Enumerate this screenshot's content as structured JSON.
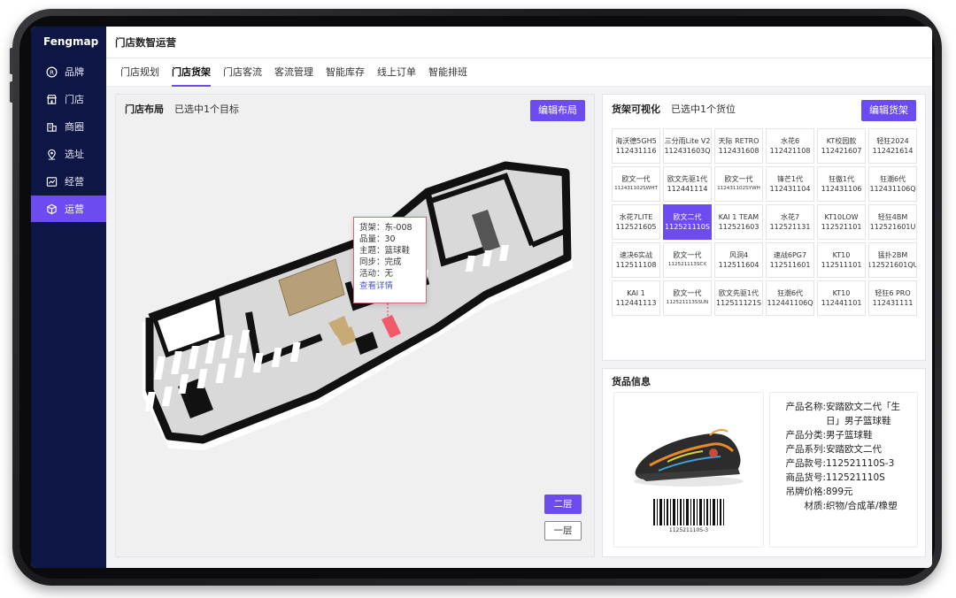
{
  "app": {
    "brand": "Fengmap",
    "title": "门店数智运营"
  },
  "sidebar": {
    "items": [
      {
        "label": "品牌",
        "icon": "registered-icon",
        "active": false
      },
      {
        "label": "门店",
        "icon": "store-icon",
        "active": false
      },
      {
        "label": "商圈",
        "icon": "building-icon",
        "active": false
      },
      {
        "label": "选址",
        "icon": "location-pin-icon",
        "active": false
      },
      {
        "label": "经营",
        "icon": "chart-line-icon",
        "active": false
      },
      {
        "label": "运营",
        "icon": "cube-icon",
        "active": true
      }
    ]
  },
  "tabs": [
    {
      "label": "门店规划",
      "active": false
    },
    {
      "label": "门店货架",
      "active": true
    },
    {
      "label": "门店客流",
      "active": false
    },
    {
      "label": "客流管理",
      "active": false
    },
    {
      "label": "智能库存",
      "active": false
    },
    {
      "label": "线上订单",
      "active": false
    },
    {
      "label": "智能排班",
      "active": false
    }
  ],
  "layout_panel": {
    "title": "门店布局",
    "status": "已选中1个目标",
    "edit_button": "编辑布局",
    "tooltip": {
      "lines": [
        "货架：东-008",
        "品量：30",
        "主题：篮球鞋",
        "同步：完成",
        "活动：无"
      ],
      "link": "查看详情"
    },
    "floors": [
      "二层",
      "一层"
    ]
  },
  "shelf_panel": {
    "title": "货架可视化",
    "status": "已选中1个货位",
    "edit_button": "编辑货架",
    "cells": [
      {
        "name": "海沃德5GH5",
        "code": "112431116"
      },
      {
        "name": "三分雨Lite V2",
        "code": "112431603Q"
      },
      {
        "name": "天际 RETRO",
        "code": "112431608"
      },
      {
        "name": "水花6",
        "code": "112421108"
      },
      {
        "name": "KT校园款",
        "code": "112421607"
      },
      {
        "name": "轻狂2024",
        "code": "112421614"
      },
      {
        "name": "欧文一代",
        "code": "112431102SWHT",
        "small": true
      },
      {
        "name": "欧文先驱1代",
        "code": "112441114"
      },
      {
        "name": "欧文一代",
        "code": "112431102SYWH",
        "small": true
      },
      {
        "name": "锋芒1代",
        "code": "112431104"
      },
      {
        "name": "狂傲1代",
        "code": "112431106"
      },
      {
        "name": "狂潮6代",
        "code": "112431106Q"
      },
      {
        "name": "水花7LITE",
        "code": "112521605"
      },
      {
        "name": "欧文二代",
        "code": "112521110S",
        "selected": true
      },
      {
        "name": "KAI 1 TEAM",
        "code": "112521603"
      },
      {
        "name": "水花7",
        "code": "112521131"
      },
      {
        "name": "KT10LOW",
        "code": "112521101"
      },
      {
        "name": "轻狂4BM",
        "code": "112521601U"
      },
      {
        "name": "速决6实战",
        "code": "112511108"
      },
      {
        "name": "欧文一代",
        "code": "112521113SCX",
        "small": true
      },
      {
        "name": "风洞4",
        "code": "112511604"
      },
      {
        "name": "速战6PG7",
        "code": "112511601"
      },
      {
        "name": "KT10",
        "code": "112511101"
      },
      {
        "name": "猛扑2BM",
        "code": "112521601QU"
      },
      {
        "name": "KAI 1",
        "code": "112441113"
      },
      {
        "name": "欧文一代",
        "code": "112521113SSUN",
        "small": true
      },
      {
        "name": "欧文先驱1代",
        "code": "112511121S"
      },
      {
        "name": "狂潮6代",
        "code": "112441106Q"
      },
      {
        "name": "KT10",
        "code": "112441101"
      },
      {
        "name": "轻狂6 PRO",
        "code": "112431111"
      }
    ]
  },
  "goods_panel": {
    "title": "货品信息",
    "barcode_number": "112521110S-3",
    "fields": [
      {
        "key": "产品名称:",
        "value": "安踏欧文二代「生日」男子篮球鞋"
      },
      {
        "key": "产品分类:",
        "value": "男子篮球鞋"
      },
      {
        "key": "产品系列:",
        "value": "安踏欧文二代"
      },
      {
        "key": "产品款号:",
        "value": "112521110S-3"
      },
      {
        "key": "商品货号:",
        "value": "112521110S"
      },
      {
        "key": "吊牌价格:",
        "value": "899元"
      },
      {
        "key": "材质:",
        "value": "织物/合成革/橡塑"
      }
    ]
  }
}
